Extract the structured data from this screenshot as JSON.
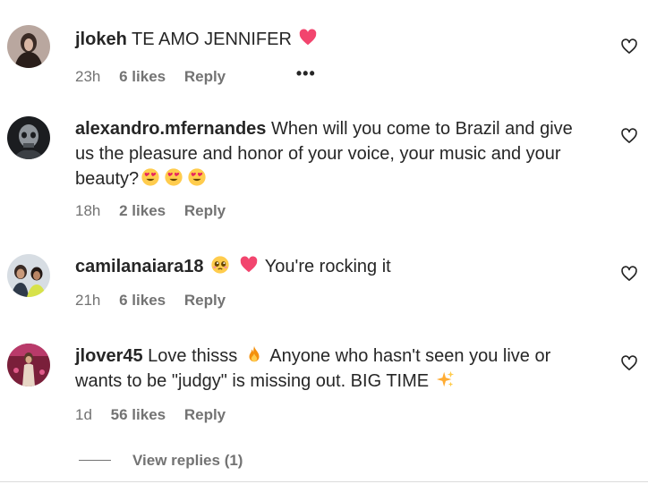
{
  "comments": [
    {
      "username": "jlokeh",
      "text_parts": [
        "TE AMO JENNIFER"
      ],
      "time": "23h",
      "likes": "6 likes",
      "reply": "Reply",
      "more": "•••"
    },
    {
      "username": "alexandro.mfernandes",
      "text_parts": [
        "When will you come to Brazil and give us the pleasure and honor of your voice, your music and your beauty?"
      ],
      "time": "18h",
      "likes": "2 likes",
      "reply": "Reply"
    },
    {
      "username": "camilanaiara18",
      "text_parts": [
        "You're rocking it"
      ],
      "time": "21h",
      "likes": "6 likes",
      "reply": "Reply"
    },
    {
      "username": "jlover45",
      "text_parts": [
        "Love thisss",
        "Anyone who hasn't seen you live or wants to be \"judgy\" is missing out. BIG TIME"
      ],
      "time": "1d",
      "likes": "56 likes",
      "reply": "Reply"
    }
  ],
  "view_replies": "View replies (1)",
  "icons": {
    "like": "heart-outline-icon",
    "heart_emoji": "pink-heart-emoji",
    "heart_eyes_emoji": "heart-eyes-emoji",
    "pleading_emoji": "pleading-face-emoji",
    "fire_emoji": "fire-emoji",
    "sparkles_emoji": "sparkles-emoji"
  },
  "colors": {
    "text": "#262626",
    "muted": "#737373",
    "heart_emoji": "#f2456e"
  }
}
